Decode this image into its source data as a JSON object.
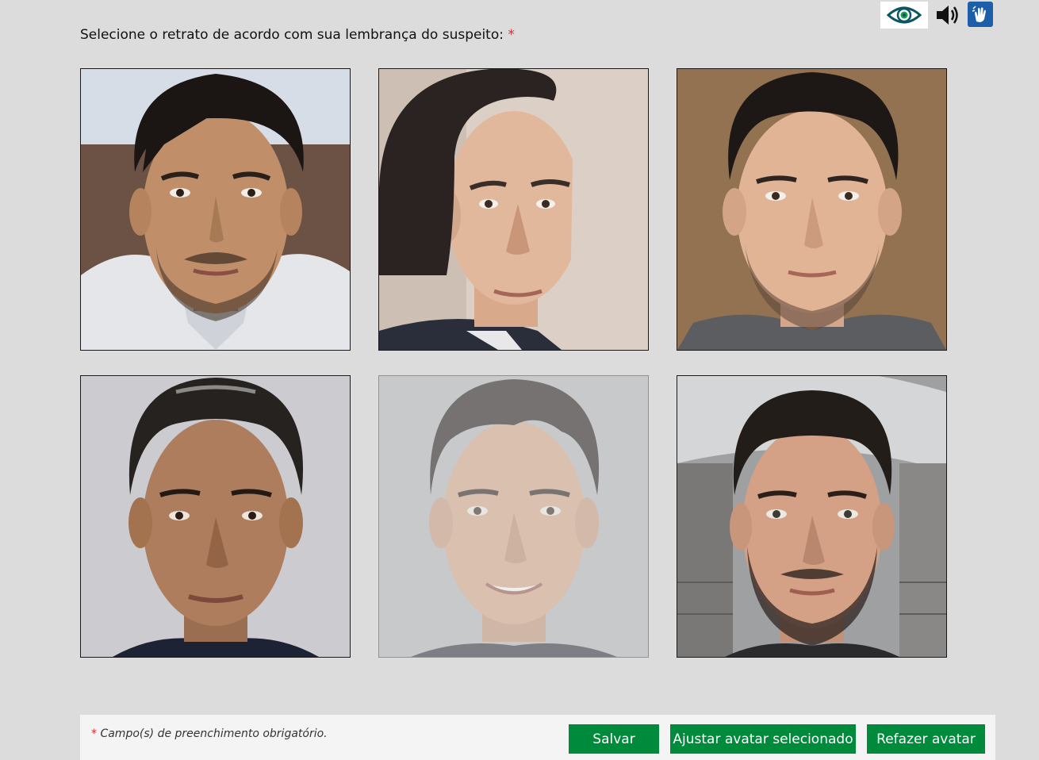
{
  "accessibility": {
    "icons": [
      "eye-icon",
      "speaker-icon",
      "sign-language-icon"
    ]
  },
  "form": {
    "prompt": "Selecione o retrato de acordo com sua lembrança do suspeito:",
    "required_mark": "*"
  },
  "portraits": [
    {
      "label": "portrait-1",
      "selected": false
    },
    {
      "label": "portrait-2",
      "selected": false
    },
    {
      "label": "portrait-3",
      "selected": false
    },
    {
      "label": "portrait-4",
      "selected": false
    },
    {
      "label": "portrait-5",
      "selected": false,
      "dimmed": true
    },
    {
      "label": "portrait-6",
      "selected": false
    }
  ],
  "footer": {
    "required_mark": "*",
    "note": "Campo(s) de preenchimento obrigatório.",
    "buttons": {
      "save": "Salvar",
      "adjust": "Ajustar avatar selecionado",
      "redo": "Refazer avatar"
    }
  },
  "colors": {
    "page_bg": "#dcdcdc",
    "button_green": "#008a3c",
    "required_red": "#d92b2b",
    "libras_blue": "#1c5fa8"
  }
}
